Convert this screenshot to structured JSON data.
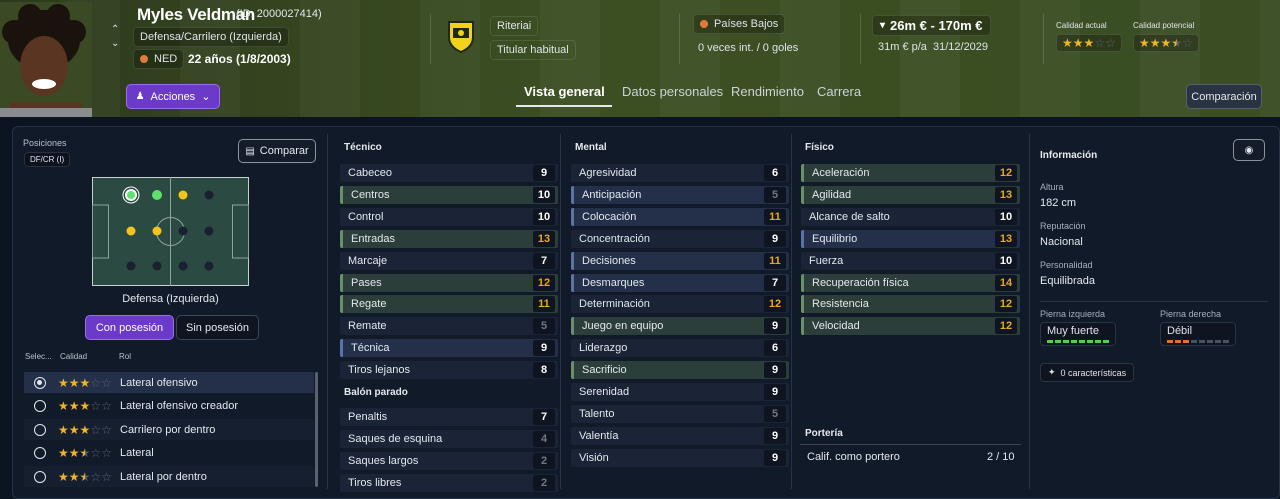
{
  "player": {
    "name": "Myles Veldman",
    "id_text": "(ID: 2000027414)",
    "position": "Defensa/Carrilero (Izquierda)",
    "nation_code": "NED",
    "age": "22 años (1/8/2003)"
  },
  "club": {
    "name": "Riteriai",
    "status": "Titular habitual"
  },
  "nation": {
    "name": "Países Bajos",
    "caps": "0 veces int. / 0 goles"
  },
  "value": {
    "range": "26m € - 170m €",
    "wage": "31m € p/a",
    "contract_end": "31/12/2029"
  },
  "ability": {
    "current_label": "Calidad actual",
    "potential_label": "Calidad potencial",
    "current_stars": 3,
    "potential_stars": 3.5
  },
  "actions_label": "Acciones",
  "tabs": [
    "Vista general",
    "Datos personales",
    "Rendimiento",
    "Carrera"
  ],
  "compare_top_label": "Comparación",
  "left": {
    "positions_label": "Posiciones",
    "position_code": "DF/CR (I)",
    "compare_label": "Comparar",
    "pitch_role": "Defensa (Izquierda)",
    "toggle_on": "Con posesión",
    "toggle_off": "Sin posesión",
    "col_select": "Selec...",
    "col_quality": "Calidad",
    "col_role": "Rol",
    "roles": [
      {
        "name": "Lateral ofensivo",
        "stars": 3,
        "selected": true
      },
      {
        "name": "Lateral ofensivo creador",
        "stars": 3,
        "selected": false
      },
      {
        "name": "Carrilero por dentro",
        "stars": 3,
        "selected": false
      },
      {
        "name": "Lateral",
        "stars": 2.5,
        "selected": false
      },
      {
        "name": "Lateral por dentro",
        "stars": 2.5,
        "selected": false
      }
    ]
  },
  "technical": {
    "title": "Técnico",
    "attrs": [
      {
        "name": "Cabeceo",
        "value": 9
      },
      {
        "name": "Centros",
        "value": 10
      },
      {
        "name": "Control",
        "value": 10
      },
      {
        "name": "Entradas",
        "value": 13
      },
      {
        "name": "Marcaje",
        "value": 7
      },
      {
        "name": "Pases",
        "value": 12
      },
      {
        "name": "Regate",
        "value": 11
      },
      {
        "name": "Remate",
        "value": 5
      },
      {
        "name": "Técnica",
        "value": 9
      },
      {
        "name": "Tiros lejanos",
        "value": 8
      }
    ]
  },
  "set_pieces": {
    "title": "Balón parado",
    "attrs": [
      {
        "name": "Penaltis",
        "value": 7
      },
      {
        "name": "Saques de esquina",
        "value": 4
      },
      {
        "name": "Saques largos",
        "value": 2
      },
      {
        "name": "Tiros libres",
        "value": 2
      }
    ]
  },
  "mental": {
    "title": "Mental",
    "attrs": [
      {
        "name": "Agresividad",
        "value": 6
      },
      {
        "name": "Anticipación",
        "value": 5
      },
      {
        "name": "Colocación",
        "value": 11
      },
      {
        "name": "Concentración",
        "value": 9
      },
      {
        "name": "Decisiones",
        "value": 11
      },
      {
        "name": "Desmarques",
        "value": 7
      },
      {
        "name": "Determinación",
        "value": 12
      },
      {
        "name": "Juego en equipo",
        "value": 9
      },
      {
        "name": "Liderazgo",
        "value": 6
      },
      {
        "name": "Sacrificio",
        "value": 9
      },
      {
        "name": "Serenidad",
        "value": 9
      },
      {
        "name": "Talento",
        "value": 5
      },
      {
        "name": "Valentía",
        "value": 9
      },
      {
        "name": "Visión",
        "value": 9
      }
    ]
  },
  "physical": {
    "title": "Físico",
    "attrs": [
      {
        "name": "Aceleración",
        "value": 12
      },
      {
        "name": "Agilidad",
        "value": 13
      },
      {
        "name": "Alcance de salto",
        "value": 10
      },
      {
        "name": "Equilibrio",
        "value": 13
      },
      {
        "name": "Fuerza",
        "value": 10
      },
      {
        "name": "Recuperación física",
        "value": 14
      },
      {
        "name": "Resistencia",
        "value": 12
      },
      {
        "name": "Velocidad",
        "value": 12
      }
    ]
  },
  "goalkeeping": {
    "title": "Portería",
    "label": "Calif. como portero",
    "value": "2 / 10"
  },
  "info": {
    "title": "Información",
    "height_label": "Altura",
    "height": "182 cm",
    "reputation_label": "Reputación",
    "reputation": "Nacional",
    "personality_label": "Personalidad",
    "personality": "Equilibrada",
    "left_foot_label": "Pierna izquierda",
    "left_foot": "Muy fuerte",
    "right_foot_label": "Pierna derecha",
    "right_foot": "Débil",
    "traits": "0 características"
  }
}
